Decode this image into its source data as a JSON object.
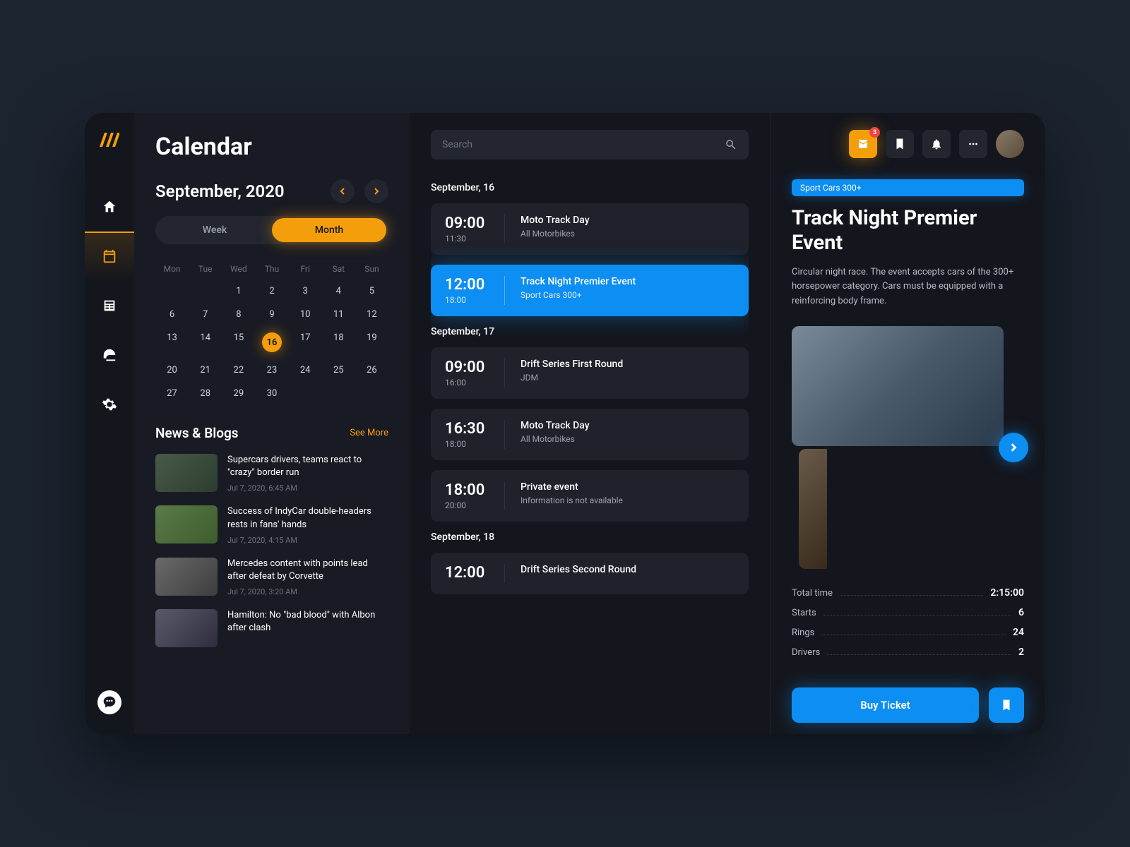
{
  "page_title": "Calendar",
  "month_label": "September, 2020",
  "view_toggle": {
    "week": "Week",
    "month": "Month"
  },
  "cal_headers": [
    "Mon",
    "Tue",
    "Wed",
    "Thu",
    "Fri",
    "Sat",
    "Sun"
  ],
  "cal_days": [
    "",
    "",
    "1",
    "2",
    "3",
    "4",
    "5",
    "6",
    "7",
    "8",
    "9",
    "10",
    "11",
    "12",
    "13",
    "14",
    "15",
    "16",
    "17",
    "18",
    "19",
    "20",
    "21",
    "22",
    "23",
    "24",
    "25",
    "26",
    "27",
    "28",
    "29",
    "30",
    "",
    "",
    ""
  ],
  "cal_selected": "16",
  "news": {
    "title": "News & Blogs",
    "see_more": "See More",
    "items": [
      {
        "headline": "Supercars drivers, teams react to \"crazy\" border run",
        "date": "Jul 7, 2020, 6:45 AM"
      },
      {
        "headline": "Success of IndyCar double-headers rests in fans' hands",
        "date": "Jul 7, 2020, 4:15 AM"
      },
      {
        "headline": "Mercedes content with points lead after defeat by Corvette",
        "date": "Jul 7, 2020, 3:20 AM"
      },
      {
        "headline": "Hamilton: No \"bad blood\" with Albon after clash",
        "date": ""
      }
    ]
  },
  "search_placeholder": "Search",
  "days": [
    {
      "label": "September, 16",
      "events": [
        {
          "start": "09:00",
          "end": "11:30",
          "title": "Moto Track Day",
          "sub": "All Motorbikes",
          "selected": false
        },
        {
          "start": "12:00",
          "end": "18:00",
          "title": "Track Night Premier Event",
          "sub": "Sport Cars 300+",
          "selected": true
        }
      ]
    },
    {
      "label": "September, 17",
      "events": [
        {
          "start": "09:00",
          "end": "16:00",
          "title": "Drift Series First Round",
          "sub": "JDM",
          "selected": false
        },
        {
          "start": "16:30",
          "end": "18:00",
          "title": "Moto Track Day",
          "sub": "All Motorbikes",
          "selected": false
        },
        {
          "start": "18:00",
          "end": "20:00",
          "title": "Private event",
          "sub": "Information is not available",
          "selected": false
        }
      ]
    },
    {
      "label": "September, 18",
      "events": [
        {
          "start": "12:00",
          "end": "",
          "title": "Drift Series Second Round",
          "sub": "",
          "selected": false
        }
      ]
    }
  ],
  "mail_badge": "3",
  "detail": {
    "tag": "Sport Cars 300+",
    "title": "Track Night Premier Event",
    "desc": "Circular night race. The event accepts cars of the 300+ horsepower category. Cars must be equipped with a reinforcing body frame.",
    "stats": [
      {
        "label": "Total time",
        "value": "2:15:00"
      },
      {
        "label": "Starts",
        "value": "6"
      },
      {
        "label": "Rings",
        "value": "24"
      },
      {
        "label": "Drivers",
        "value": "2"
      }
    ],
    "buy": "Buy Ticket"
  }
}
